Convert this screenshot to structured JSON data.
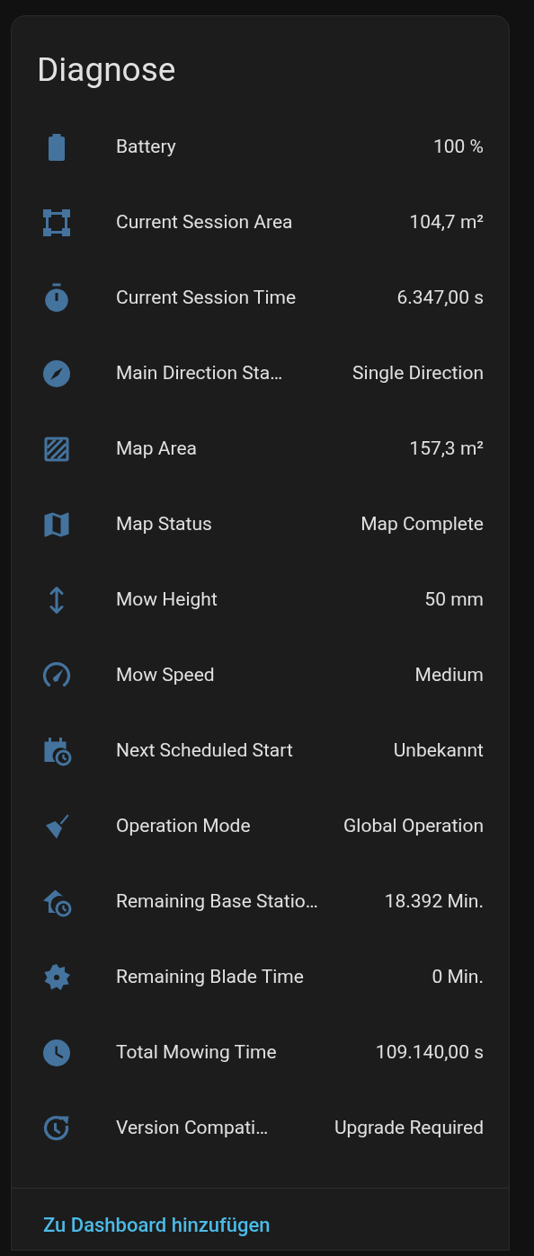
{
  "card": {
    "title": "Diagnose",
    "rows": [
      {
        "label": "Battery",
        "value": "100 %"
      },
      {
        "label": "Current Session Area",
        "value": "104,7 m²"
      },
      {
        "label": "Current Session Time",
        "value": "6.347,00 s"
      },
      {
        "label": "Main Direction Sta…",
        "value": "Single Direction"
      },
      {
        "label": "Map Area",
        "value": "157,3 m²"
      },
      {
        "label": "Map Status",
        "value": "Map Complete"
      },
      {
        "label": "Mow Height",
        "value": "50 mm"
      },
      {
        "label": "Mow Speed",
        "value": "Medium"
      },
      {
        "label": "Next Scheduled Start",
        "value": "Unbekannt"
      },
      {
        "label": "Operation Mode",
        "value": "Global Operation"
      },
      {
        "label": "Remaining Base Statio…",
        "value": "18.392 Min."
      },
      {
        "label": "Remaining Blade Time",
        "value": "0 Min."
      },
      {
        "label": "Total Mowing Time",
        "value": "109.140,00 s"
      },
      {
        "label": "Version Compati…",
        "value": "Upgrade Required"
      }
    ],
    "link": "Zu Dashboard hinzufügen"
  }
}
